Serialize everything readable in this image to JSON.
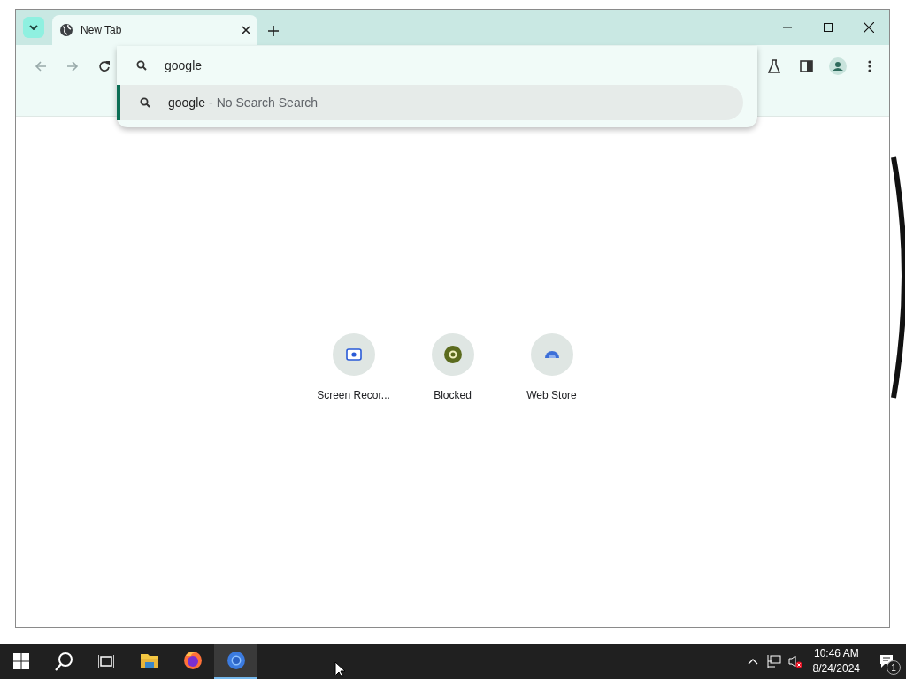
{
  "browser": {
    "tabs": [
      {
        "title": "New Tab",
        "selected": true
      }
    ],
    "omnibox": {
      "value": "google",
      "suggestions": [
        {
          "text": "google",
          "separator": "-",
          "description": "No Search Search",
          "selected": true
        }
      ]
    },
    "shortcuts": [
      {
        "label": "Screen Recor...",
        "kind": "recorder"
      },
      {
        "label": "Blocked",
        "kind": "blocked"
      },
      {
        "label": "Web Store",
        "kind": "store"
      }
    ]
  },
  "taskbar": {
    "apps": [
      {
        "kind": "explorer",
        "active": false
      },
      {
        "kind": "firefox",
        "active": false
      },
      {
        "kind": "chrome",
        "active": true
      }
    ],
    "clock": {
      "time": "10:46 AM",
      "date": "8/24/2024"
    },
    "notifications": {
      "count": "1"
    }
  }
}
